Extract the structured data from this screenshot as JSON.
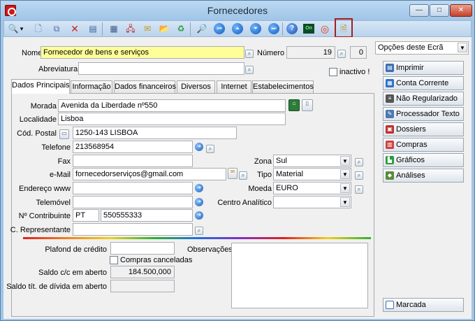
{
  "window": {
    "title": "Fornecedores",
    "min_label": "—",
    "max_label": "□",
    "close_label": "✕"
  },
  "toolbar": {
    "icons": [
      "search-icon",
      "new-document-icon",
      "copy-icon",
      "delete-icon",
      "properties-icon",
      "grid-icon",
      "network-icon",
      "email-icon",
      "folder-open-icon",
      "refresh-icon",
      "print-preview-icon",
      "first-record-icon",
      "previous-record-icon",
      "next-record-icon",
      "last-record-icon",
      "help-icon",
      "online-icon",
      "lifebuoy-icon",
      "document-icon"
    ],
    "glyphs": {
      "search": "🔍",
      "dropdown": "▾",
      "new": "🗋",
      "copy": "⧉",
      "delete": "✕",
      "properties": "▤",
      "grid": "▦",
      "network": "🖧",
      "email": "✉",
      "folder": "📂",
      "refresh": "♻",
      "preview": "🔎",
      "first": "⏮",
      "prev": "⏶",
      "next": "⏷",
      "last": "⏭",
      "help": "?",
      "online": "On",
      "lifebuoy": "◎",
      "doc": "🗎"
    }
  },
  "header": {
    "nome_label": "Nome",
    "nome_value": "Fornecedor de bens e serviços",
    "numero_label": "Número",
    "numero_value": "19",
    "numero_sub": "0",
    "abreviatura_label": "Abreviatura",
    "abreviatura_value": "",
    "inactivo_label": "inactivo !"
  },
  "tabs": [
    "Dados Principais",
    "Informação",
    "Dados financeiros",
    "Diversos",
    "Internet",
    "Estabelecimentos"
  ],
  "main": {
    "morada_label": "Morada",
    "morada_value": "Avenida da Liberdade nº550",
    "localidade_label": "Localidade",
    "localidade_value": "Lisboa",
    "cod_postal_label": "Cód. Postal",
    "cod_postal_value": "1250-143 LISBOA",
    "telefone_label": "Telefone",
    "telefone_value": "213568954",
    "fax_label": "Fax",
    "fax_value": "",
    "email_label": "e-Mail",
    "email_value": "fornecedorserviços@gmail.com",
    "endereco_label": "Endereço www",
    "endereco_value": "",
    "telemovel_label": "Telemóvel",
    "telemovel_value": "",
    "contribuinte_label": "Nº Contribuinte",
    "contribuinte_prefix": "PT",
    "contribuinte_value": "550555333",
    "representante_label": "C. Representante",
    "representante_value": "",
    "zona_label": "Zona",
    "zona_value": "Sul",
    "tipo_label": "Tipo",
    "tipo_value": "Material",
    "moeda_label": "Moeda",
    "moeda_value": "EURO",
    "centro_label": "Centro Analítico",
    "centro_value": ""
  },
  "finance": {
    "plafond_label": "Plafond de crédito",
    "plafond_value": "",
    "compras_canceladas_label": "Compras canceladas",
    "saldo_cc_label": "Saldo c/c em aberto",
    "saldo_cc_value": "184.500,000",
    "saldo_tit_label": "Saldo tít. de dívida em aberto",
    "saldo_tit_value": "",
    "observacoes_label": "Observações"
  },
  "sidebar": {
    "options_label": "Opções deste Ecrã",
    "buttons": [
      {
        "label": "Imprimir",
        "color": "#3d6fb5"
      },
      {
        "label": "Conta Corrente",
        "color": "#2f72c8"
      },
      {
        "label": "Não Regularizado",
        "color": "#555555"
      },
      {
        "label": "Processador Texto",
        "color": "#4a7ab0"
      },
      {
        "label": "Dossiers",
        "color": "#c03030"
      },
      {
        "label": "Compras",
        "color": "#d04040"
      },
      {
        "label": "Gráficos",
        "color": "#2a9a3a"
      },
      {
        "label": "Análises",
        "color": "#5a8a3a"
      }
    ],
    "marcada_label": "Marcada"
  }
}
